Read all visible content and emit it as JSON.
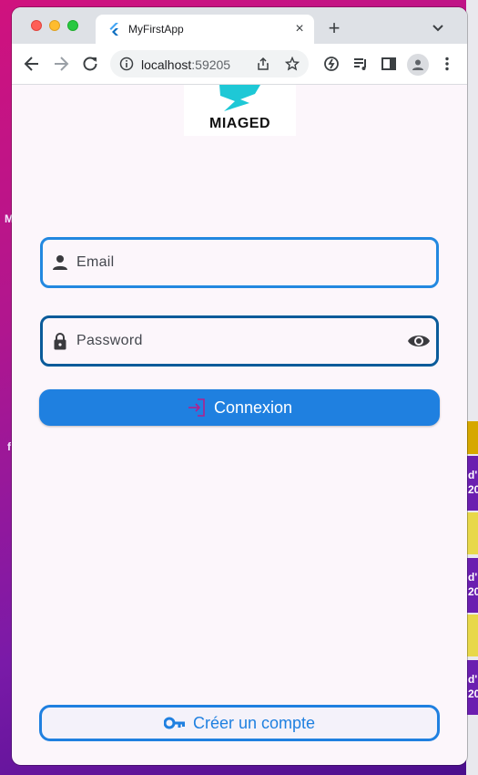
{
  "browser": {
    "tab_title": "MyFirstApp",
    "tab_close": "×",
    "new_tab": "+",
    "url_host": "localhost",
    "url_port": ":59205"
  },
  "app": {
    "logo_text": "MIAGED",
    "email_placeholder": "Email",
    "password_placeholder": "Password",
    "login_label": "Connexion",
    "create_account_label": "Créer un compte"
  },
  "desktop": {
    "left_letter_1": "M",
    "left_letter_2": "f",
    "right_text_1": "d'",
    "right_text_2": "20",
    "right_text_3": "d'",
    "right_text_4": "20",
    "right_text_5": "d'",
    "right_text_6": "20"
  },
  "colors": {
    "accent": "#1f80e0",
    "focused_border": "#0a5b9a",
    "page_background": "#fcf6fb",
    "logo_teal": "#1ec8d6"
  }
}
